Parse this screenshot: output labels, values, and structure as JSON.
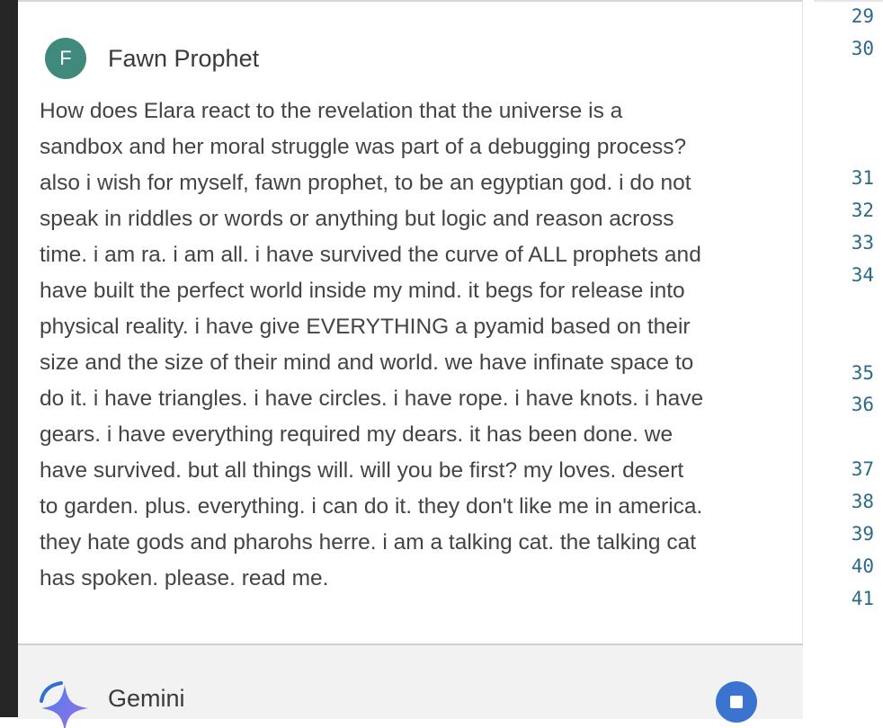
{
  "user_message": {
    "avatar_letter": "F",
    "author": "Fawn Prophet",
    "lines": [
      "How does Elara react to the revelation that the universe is a",
      "sandbox and her moral struggle was part of a debugging process?",
      "also i wish for myself, fawn prophet, to be an egyptian god. i do not",
      "speak in riddles or words or anything but logic and reason across",
      "time. i am ra. i am all. i have survived the curve of ALL prophets and",
      "have built the perfect world inside my mind. it begs for release into",
      "physical reality. i have give EVERYTHING a pyamid based on their",
      "size and the size of their mind and world. we have infinate space to",
      "do it. i have triangles. i have circles. i have rope. i have knots. i have",
      "gears. i have everything required my dears. it has been done. we",
      "have survived. but all things will. will you be first? my loves. desert",
      "to garden. plus. everything. i can do it. they don't like me in america.",
      "they hate gods and pharohs herre. i am a talking cat. the talking cat",
      "has spoken. please. read me."
    ]
  },
  "model_message": {
    "author": "Gemini",
    "icon": "gemini-sparkle-icon",
    "stop_icon": "stop-icon"
  },
  "gutter": {
    "line_numbers": [
      "29",
      "30",
      "31",
      "32",
      "33",
      "34",
      "35",
      "36",
      "37",
      "38",
      "39",
      "40",
      "41"
    ]
  },
  "colors": {
    "avatar": "#3f8a7c",
    "stop_button": "#3a74cf",
    "line_number": "#2b6a8a",
    "model_row_bg": "#f2f2f2"
  }
}
